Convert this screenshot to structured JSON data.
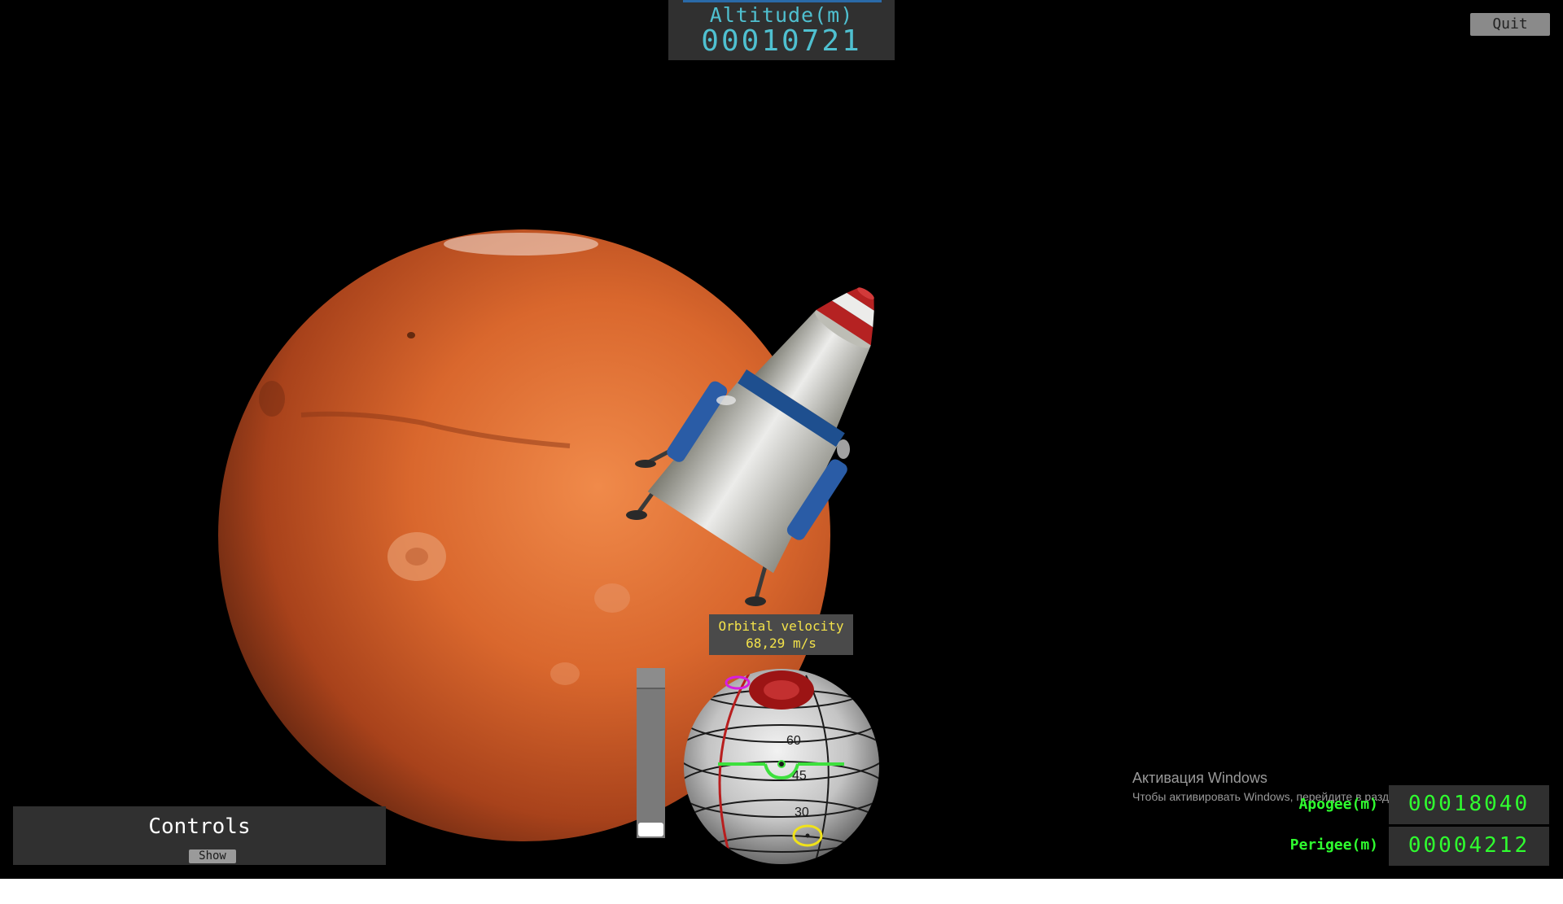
{
  "hud": {
    "altitude": {
      "label": "Altitude(m)",
      "value": "00010721"
    },
    "quit_label": "Quit",
    "controls": {
      "title": "Controls",
      "show_label": "Show"
    },
    "orbital_velocity": {
      "label": "Orbital velocity",
      "value": "68,29 m/s"
    },
    "throttle_level": 0.08,
    "apogee": {
      "label": "Apogee(m)",
      "value": "00018040"
    },
    "perigee": {
      "label": "Perigee(m)",
      "value": "00004212"
    },
    "attitude_ball_ticks": [
      "60",
      "45",
      "30"
    ]
  },
  "watermark": {
    "title": "Активация Windows",
    "subtitle": "Чтобы активировать Windows, перейдите в раздел \"Параметры\"."
  },
  "colors": {
    "altitude_text": "#4fc0d0",
    "orbit_text": "#2fff2f",
    "velocity_text": "#f3e24a",
    "panel": "#303030",
    "planet": "#d46530",
    "space": "#000000"
  }
}
